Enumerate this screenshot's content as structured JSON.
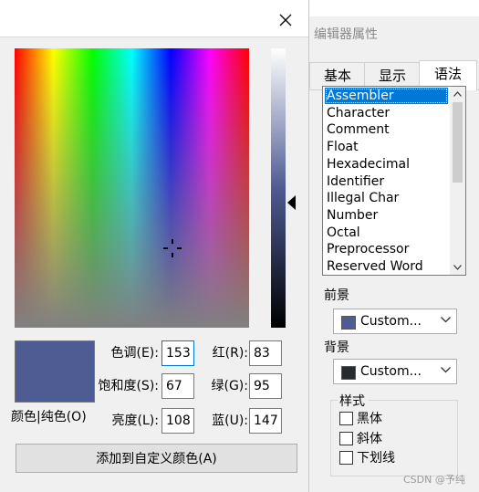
{
  "color_dialog": {
    "close_glyph": "✕",
    "color_solid_label": "颜色|纯色(O)",
    "fields": {
      "hue": {
        "label": "色调(E):",
        "value": "153"
      },
      "saturation": {
        "label": "饱和度(S):",
        "value": "67"
      },
      "luminance": {
        "label": "亮度(L):",
        "value": "108"
      },
      "red": {
        "label": "红(R):",
        "value": "83"
      },
      "green": {
        "label": "绿(G):",
        "value": "95"
      },
      "blue": {
        "label": "蓝(U):",
        "value": "147"
      }
    },
    "add_custom_label": "添加到自定义颜色(A)",
    "current_color": "#4f5b93"
  },
  "properties": {
    "title": "编辑器属性",
    "tabs": [
      "基本",
      "显示",
      "语法"
    ],
    "active_tab": "语法",
    "syntax_items": [
      "Assembler",
      "Character",
      "Comment",
      "Float",
      "Hexadecimal",
      "Identifier",
      "Illegal Char",
      "Number",
      "Octal",
      "Preprocessor",
      "Reserved Word"
    ],
    "selected_item": "Assembler",
    "foreground_label": "前景",
    "foreground_value": "Custom...",
    "foreground_color": "#4f5b93",
    "background_label": "背景",
    "background_value": "Custom...",
    "background_color": "#262b2f",
    "style_group_label": "样式",
    "styles": [
      "黑体",
      "斜体",
      "下划线"
    ]
  },
  "watermark": "CSDN @予纯"
}
